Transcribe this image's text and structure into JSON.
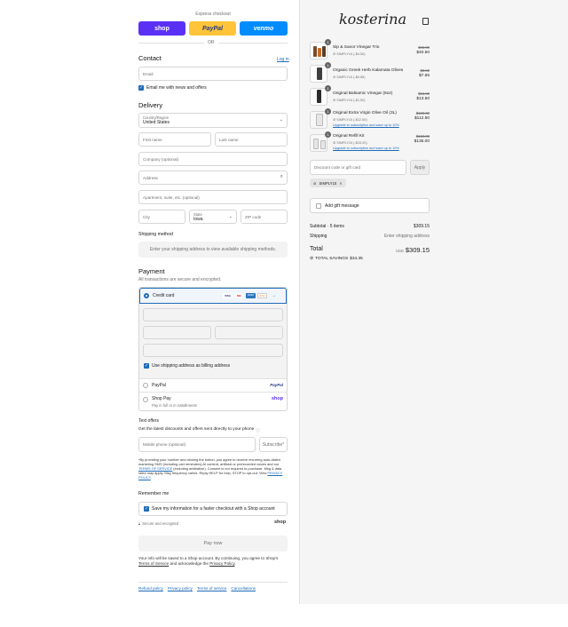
{
  "express": {
    "title": "Express checkout",
    "shop_label": "shop",
    "paypal_label": "PayPal",
    "venmo_label": "venmo",
    "or_label": "OR"
  },
  "contact": {
    "heading": "Contact",
    "login_link": "Log in",
    "email_placeholder": "Email",
    "newsletter_label": "Email me with news and offers"
  },
  "delivery": {
    "heading": "Delivery",
    "country_label": "Country/Region",
    "country_value": "United States",
    "first_name": "First name",
    "last_name": "Last name",
    "company": "Company (optional)",
    "address": "Address",
    "apartment": "Apartment, suite, etc. (optional)",
    "city": "City",
    "state_label": "State",
    "state_value": "Iowa",
    "zip": "ZIP code"
  },
  "shipping": {
    "heading": "Shipping method",
    "message": "Enter your shipping address to view available shipping methods."
  },
  "payment": {
    "heading": "Payment",
    "subtitle": "All transactions are secure and encrypted.",
    "credit_card_label": "Credit card",
    "card_logos": [
      "VISA",
      "MC",
      "AMEX",
      "DISC"
    ],
    "billing_label": "Use shipping address as billing address",
    "paypal_label": "PayPal",
    "paypal_logo": "PayPal",
    "shoppay_label": "Shop Pay",
    "shoppay_sub": "Pay in full or in installments",
    "shoppay_logo": "shop"
  },
  "text_offers": {
    "heading": "Text offers",
    "subtitle": "Get the latest discounts and offers sent directly to your phone",
    "phone_placeholder": "Mobile phone (optional)",
    "subscribe_label": "Subscribe*",
    "disclaimer_a": "*By providing your number and clicking the button, you agree to receive recurring auto-dialed marketing SMS (including cart reminders) AI content, artificial or prerecorded voices and our",
    "terms_link": "TERMS OF SERVICE",
    "disclaimer_b": "(including arbitration). Consent is not required to purchase. Msg & data rates may apply. Msg frequency varies. Reply HELP for help, STOP to opt-out. View",
    "privacy_link": "PRIVACY POLICY",
    "disclaimer_c": "."
  },
  "remember": {
    "heading": "Remember me",
    "save_label": "Save my information for a faster checkout with a Shop account",
    "secure_label": "Secure and encrypted",
    "shop_logo": "shop"
  },
  "pay_button": "Pay now",
  "consent": {
    "text_a": "Your info will be saved to a Shop account. By continuing, you agree to Shop's",
    "terms": "Terms of Service",
    "text_b": "and acknowledge the",
    "privacy": "Privacy Policy",
    "text_c": "."
  },
  "footer_links": [
    "Refund policy",
    "Privacy policy",
    "Terms of service",
    "Cancellations"
  ],
  "brand": {
    "logo": "kosterina"
  },
  "cart": {
    "items": [
      {
        "name": "Sip & Savor Vinegar Trio",
        "qty": "1",
        "discount": "SIMPLY10 (-$4.50)",
        "old": "$45.00",
        "price": "$40.50",
        "upgrade": ""
      },
      {
        "name": "Organic Greek Herb Kalamata Olives",
        "qty": "1",
        "discount": "SIMPLY10 (-$0.85)",
        "old": "$8.50",
        "price": "$7.65",
        "upgrade": ""
      },
      {
        "name": "Original Balsamic Vinegar (8oz)",
        "qty": "1",
        "discount": "SIMPLY10 (-$1.50)",
        "old": "$15.00",
        "price": "$13.50",
        "upgrade": ""
      },
      {
        "name": "Original Extra Virgin Olive Oil (3L)",
        "qty": "1",
        "discount": "SIMPLY10 (-$12.50)",
        "old": "$125.00",
        "price": "$112.50",
        "upgrade": "Upgrade to subscription and save up to 10%"
      },
      {
        "name": "Original Refill Kit",
        "qty": "1",
        "discount": "SIMPLY10 (-$15.00)",
        "old": "$150.00",
        "price": "$135.00",
        "upgrade": "Upgrade to subscription and save up to 10%"
      }
    ],
    "discount_placeholder": "Discount code or gift card",
    "apply_label": "Apply",
    "applied_code": "SIMPLY10",
    "gift_label": "Add gift message",
    "subtotal_label": "Subtotal · 5 items",
    "subtotal_value": "$309.15",
    "shipping_label": "Shipping",
    "shipping_value": "Enter shipping address",
    "total_label": "Total",
    "currency": "USD",
    "total_value": "$309.15",
    "savings_label": "TOTAL SAVINGS",
    "savings_value": "$34.35"
  },
  "colors": {
    "shop": "#5a31f4",
    "paypal": "#ffc439",
    "venmo": "#008cff",
    "accent": "#1f6bb8"
  }
}
